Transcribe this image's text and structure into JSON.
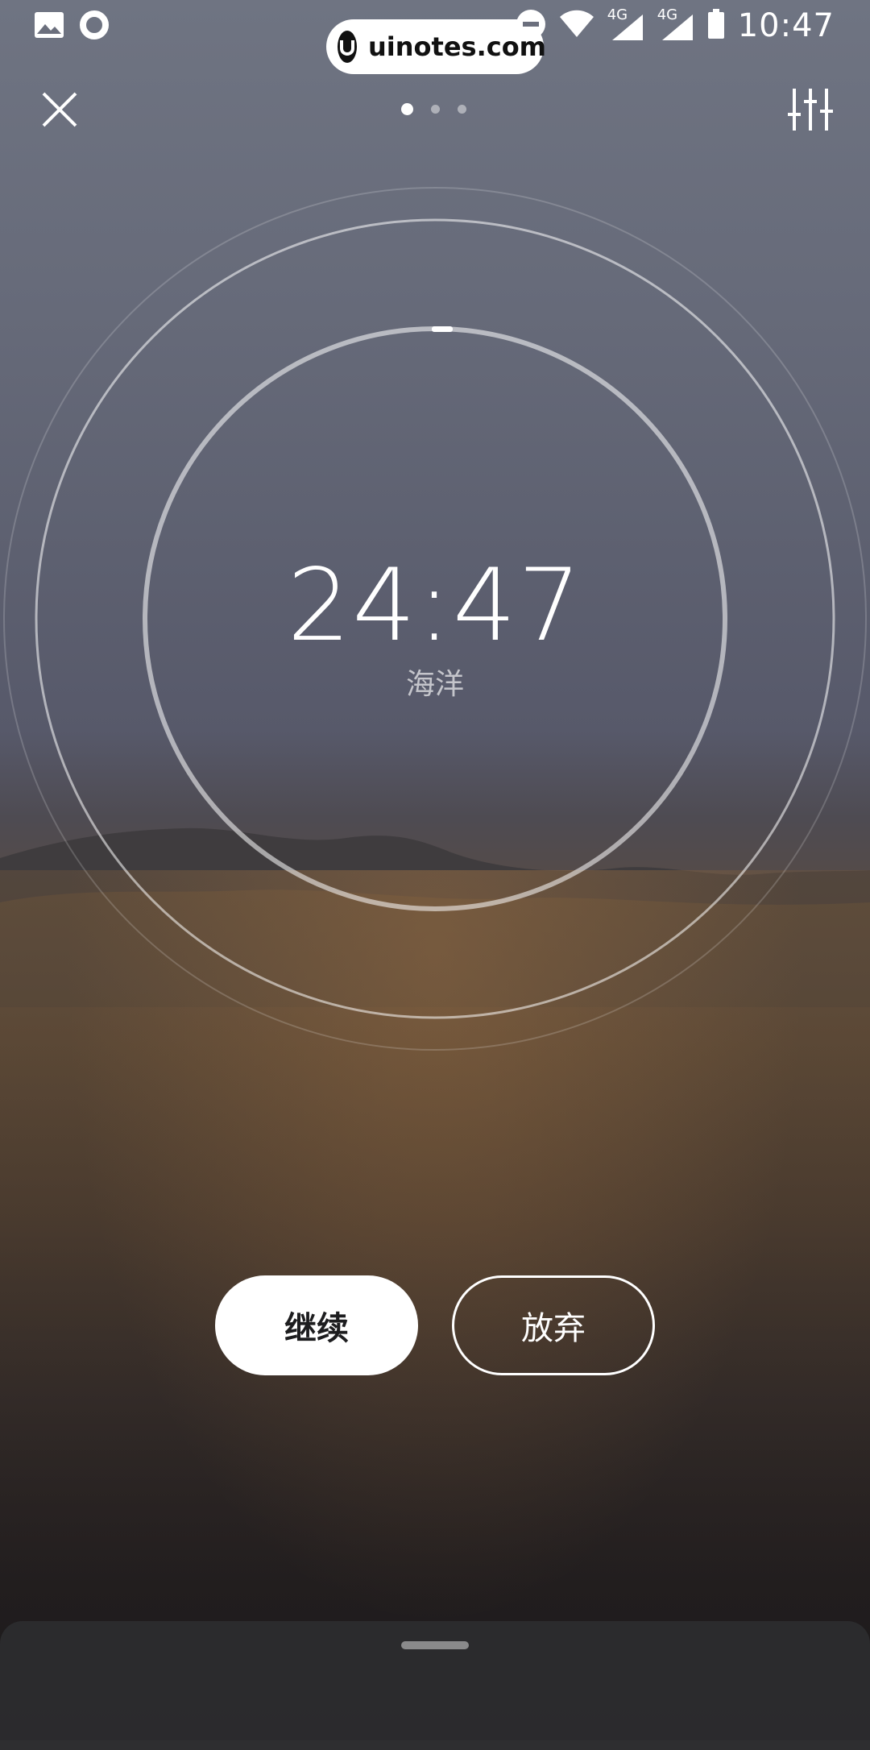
{
  "status_bar": {
    "time": "10:47",
    "network_labels": [
      "4G",
      "4G"
    ],
    "icons": [
      "gallery-icon",
      "circle-notification-icon",
      "do-not-disturb-icon",
      "wifi-icon",
      "signal-icon",
      "signal-icon",
      "battery-icon"
    ]
  },
  "watermark": {
    "text": "uinotes.com"
  },
  "top_bar": {
    "close_icon": "close-icon",
    "settings_icon": "equalizer-icon",
    "page_indicator": {
      "count": 3,
      "active_index": 0
    }
  },
  "timer": {
    "time": "24:47",
    "sound_name": "海洋"
  },
  "actions": {
    "continue_label": "继续",
    "give_up_label": "放弃"
  },
  "colors": {
    "button_primary_bg": "#ffffff",
    "button_primary_text": "#1d1d1f",
    "ring": "#ffffff"
  }
}
